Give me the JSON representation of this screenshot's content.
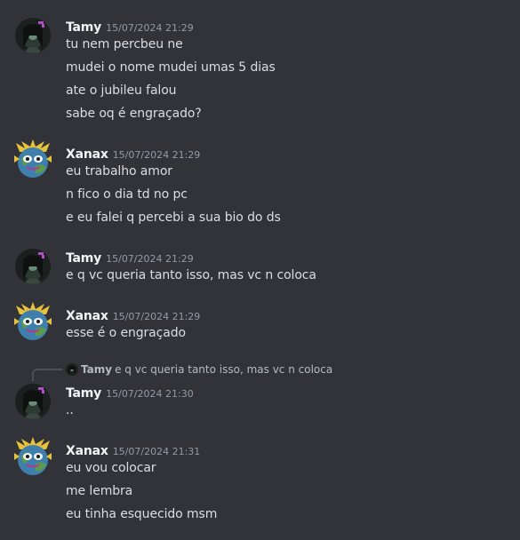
{
  "messages": [
    {
      "author": "Tamy",
      "timestamp": "15/07/2024 21:29",
      "lines": [
        "tu nem percbeu ne",
        "mudei o nome mudei umas 5 dias",
        "ate o jubileu falou",
        "sabe oq é engraçado?"
      ]
    },
    {
      "author": "Xanax",
      "timestamp": "15/07/2024 21:29",
      "lines": [
        "eu trabalho amor",
        "n fico o dia td no pc",
        "e eu falei q percebi a sua bio do ds"
      ]
    },
    {
      "author": "Tamy",
      "timestamp": "15/07/2024 21:29",
      "lines": [
        "e q vc queria tanto isso, mas vc n coloca"
      ]
    },
    {
      "author": "Xanax",
      "timestamp": "15/07/2024 21:29",
      "lines": [
        "esse é o engraçado"
      ]
    },
    {
      "reply": {
        "author": "Tamy",
        "text": "e q vc queria tanto isso, mas vc n coloca"
      },
      "author": "Tamy",
      "timestamp": "15/07/2024 21:30",
      "lines": [
        ".."
      ]
    },
    {
      "author": "Xanax",
      "timestamp": "15/07/2024 21:31",
      "lines": [
        "eu vou colocar",
        "me lembra",
        "eu tinha esquecido msm"
      ]
    }
  ],
  "colors": {
    "background": "#313338",
    "username": "#f2f3f5",
    "text": "#dbdee1",
    "timestamp": "#949ba4"
  }
}
